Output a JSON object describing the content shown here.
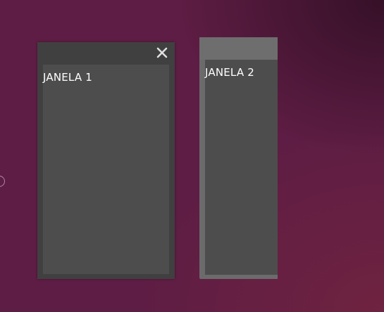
{
  "desktop": {
    "background_color": "#5e1d44"
  },
  "windows": [
    {
      "label": "JANELA 1",
      "frame_color": "#404040",
      "content_color": "#4d4d4d",
      "has_close_button": true,
      "close_icon": "close-icon"
    },
    {
      "label": "JANELA 2",
      "frame_color": "#6b6b6b",
      "content_color": "#4d4d4d",
      "has_close_button": false
    }
  ]
}
